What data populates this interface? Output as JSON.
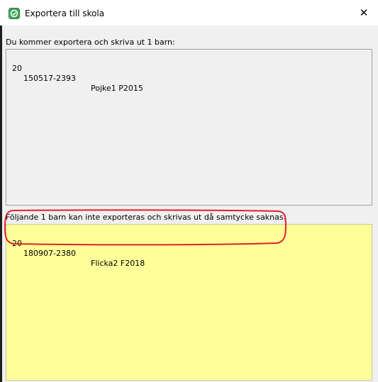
{
  "window": {
    "title": "Exportera till skola",
    "app_icon": "app-logo-icon",
    "close_icon": "close-icon",
    "close_glyph": "✕"
  },
  "export_section": {
    "label": "Du kommer exportera och skriva ut 1 barn:",
    "items": [
      {
        "num": "20",
        "id": "150517-2393",
        "name": "Pojke1 P2015"
      }
    ]
  },
  "missing_consent_section": {
    "label": "Följande 1 barn kan inte exporteras och skrivas ut då samtycke saknas:",
    "items": [
      {
        "num": "20",
        "id": "180907-2380",
        "name": "Flicka2 F2018"
      }
    ]
  },
  "colors": {
    "highlight_list": "#ffff99",
    "annotation": "#e0202a"
  }
}
